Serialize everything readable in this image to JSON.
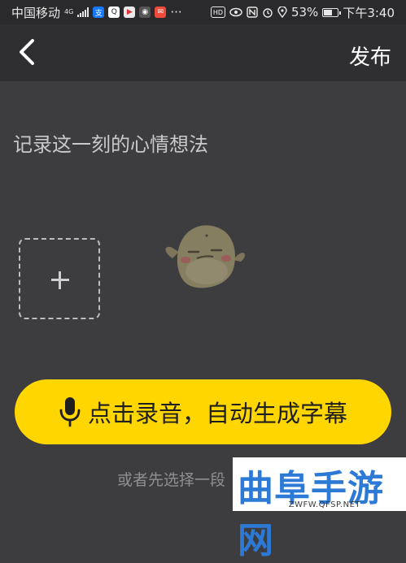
{
  "status_bar": {
    "carrier": "中国移动",
    "network_type": "4G",
    "battery_percent": "53%",
    "time": "下午3:40",
    "app_icons": [
      "alipay-icon",
      "qq-icon",
      "video-app-icon",
      "camera-app-icon",
      "notification-app-icon"
    ],
    "system_icons": [
      "hd-icon",
      "eye-icon",
      "nfc-icon",
      "alarm-icon",
      "location-icon"
    ]
  },
  "nav": {
    "publish_label": "发布"
  },
  "content": {
    "prompt": "记录这一刻的心情想法"
  },
  "record": {
    "label": "点击录音，自动生成字幕"
  },
  "hint": "或者先选择一段",
  "watermark": {
    "title": "曲阜手游网",
    "url": "ZWFW.QFSP.NET"
  },
  "colors": {
    "background": "#3d3d40",
    "nav_background": "#2f2f31",
    "accent_yellow": "#ffd600",
    "watermark_blue": "#2c79d6"
  }
}
